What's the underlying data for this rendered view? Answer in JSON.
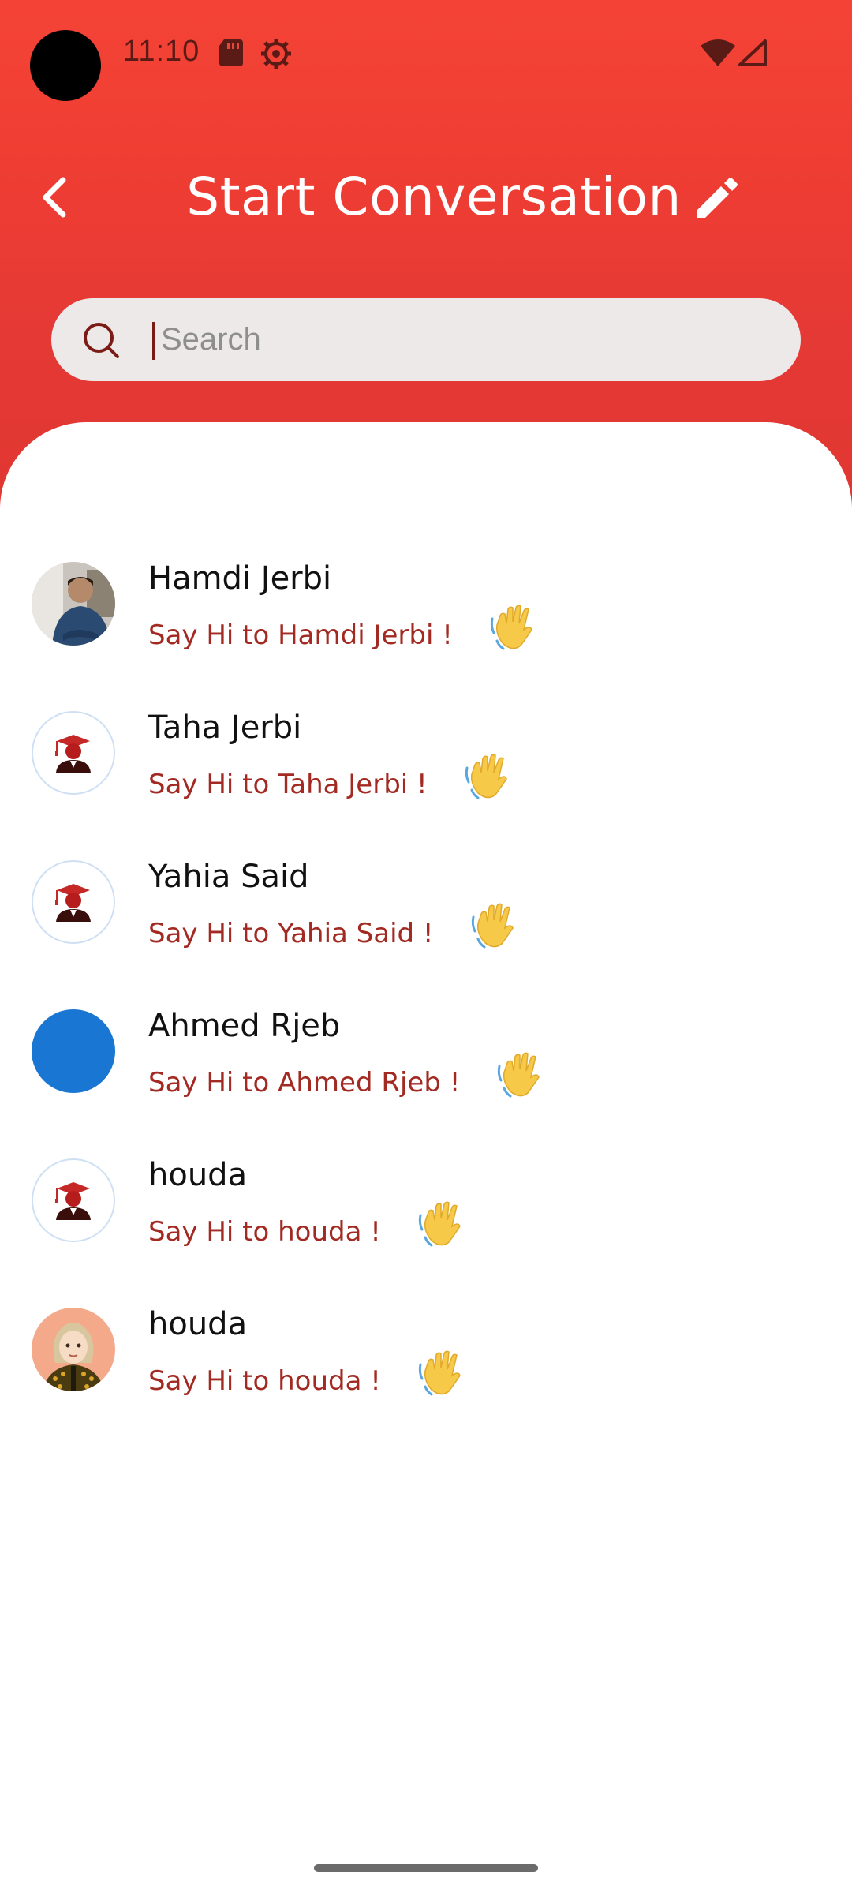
{
  "status_bar": {
    "time": "11:10",
    "icons": [
      "sd-card-icon",
      "gear-icon",
      "wifi-icon",
      "signal-icon"
    ]
  },
  "header": {
    "title": "Start Conversation",
    "back_icon": "chevron-left-icon",
    "edit_icon": "pencil-icon",
    "gradient_top": "#f44336",
    "gradient_bottom": "#df3630"
  },
  "search": {
    "placeholder": "Search",
    "value": ""
  },
  "contacts": [
    {
      "name": "Hamdi Jerbi",
      "subtitle": "Say Hi to Hamdi Jerbi !",
      "avatar": "photo-man"
    },
    {
      "name": "Taha Jerbi",
      "subtitle": "Say Hi to Taha Jerbi !",
      "avatar": "graduate-default"
    },
    {
      "name": "Yahia Said",
      "subtitle": "Say Hi to Yahia Said !",
      "avatar": "graduate-default"
    },
    {
      "name": "Ahmed Rjeb",
      "subtitle": "Say Hi to Ahmed Rjeb !",
      "avatar": "blue-circle"
    },
    {
      "name": "houda",
      "subtitle": "Say Hi to houda !",
      "avatar": "graduate-default"
    },
    {
      "name": "houda",
      "subtitle": "Say Hi to houda !",
      "avatar": "illustrated-woman"
    }
  ],
  "colors": {
    "accent": "#e53935",
    "subtitle": "#a32a22",
    "wave": "#f7c948"
  }
}
